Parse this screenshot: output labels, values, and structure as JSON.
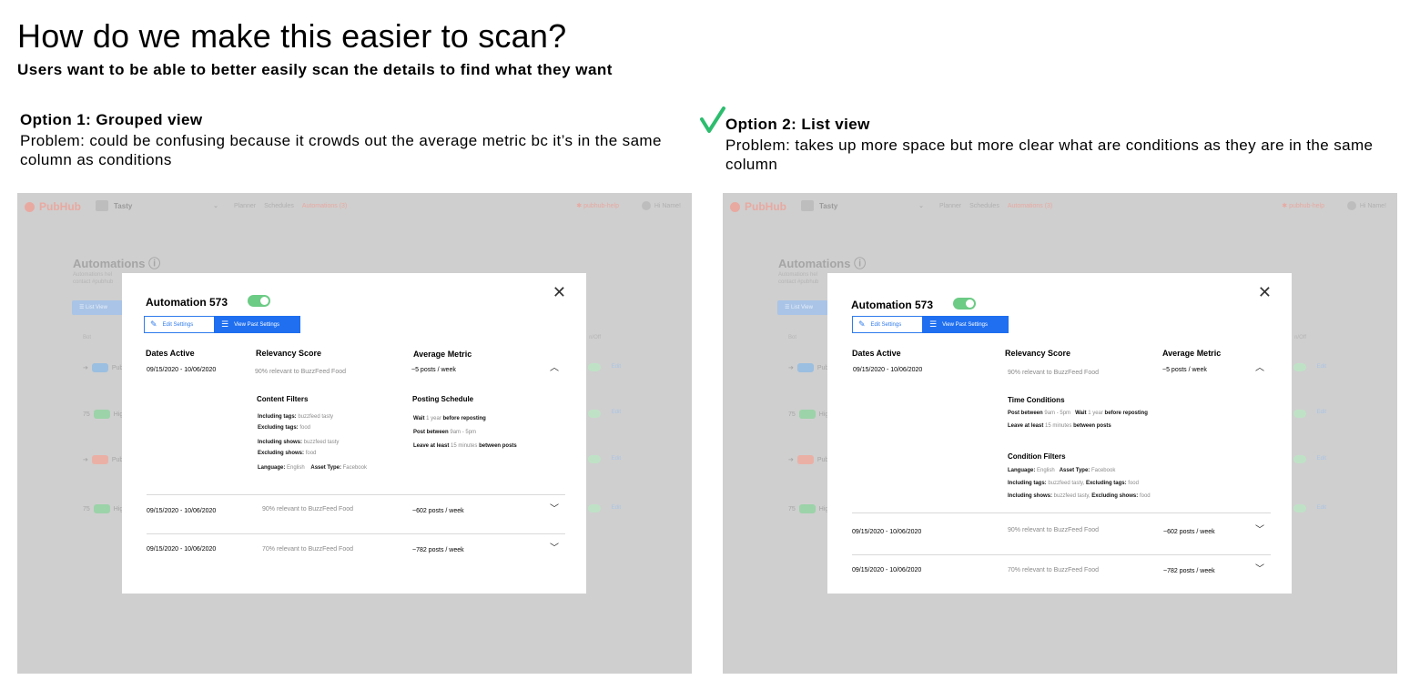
{
  "page": {
    "title": "How do we make this easier to scan?",
    "subtitle": "Users want to be able to better easily scan the details to find what they want"
  },
  "options": [
    {
      "title": "Option 1: Grouped view",
      "problem": "Problem: could be confusing because it crowds out the average metric bc it’s in the same column as conditions",
      "chosen": false
    },
    {
      "title": "Option 2: List view",
      "problem": "Problem: takes up more space but more clear what are conditions as they are in the same column",
      "chosen": true,
      "check_icon": "checkmark-icon",
      "check_color": "#2dbd6e"
    }
  ],
  "app": {
    "logo": "PubHub",
    "brand": "Tasty",
    "nav": [
      "Planner",
      "Schedules",
      "Automations (3)"
    ],
    "help": "pubhub-help",
    "user": "Hi Name!",
    "bg_title": "Automations",
    "bg_desc_1": "Automations hel",
    "bg_desc_2": "contact #pubhub",
    "bg_list_btn": "List View",
    "bg_col": "Bot",
    "bg_onoff": "n/Off",
    "bg_rows": [
      {
        "prefix": "➔",
        "badge": "blue",
        "text": "Pub"
      },
      {
        "prefix": "75",
        "badge": "green",
        "text": "High"
      },
      {
        "prefix": "➔",
        "badge": "red",
        "text": "Publ"
      },
      {
        "prefix": "75",
        "badge": "green",
        "text": "High"
      }
    ],
    "edit": "Edit"
  },
  "modal": {
    "title": "Automation 573",
    "toggle_on": true,
    "edit_settings": "Edit Settings",
    "view_past": "View Past Settings",
    "headers": [
      "Dates Active",
      "Relevancy Score",
      "Average Metric"
    ],
    "rows": [
      {
        "dates": "09/15/2020 - 10/06/2020",
        "relevancy": "90% relevant to BuzzFeed Food",
        "metric": "~5 posts / week",
        "expanded": true
      },
      {
        "dates": "09/15/2020 - 10/06/2020",
        "relevancy": "90% relevant to BuzzFeed Food",
        "metric": "~602 posts / week",
        "expanded": false
      },
      {
        "dates": "09/15/2020 - 10/06/2020",
        "relevancy": "70% relevant to BuzzFeed Food",
        "metric": "~782 posts / week",
        "expanded": false
      }
    ],
    "opt1": {
      "content_filters": "Content Filters",
      "posting_schedule": "Posting Schedule",
      "cf": {
        "including_tags_l": "Including tags:",
        "including_tags_v": "buzzfeed tasty",
        "excluding_tags_l": "Excluding tags:",
        "excluding_tags_v": "food",
        "including_shows_l": "Including shows:",
        "including_shows_v": "buzzfeed tasty",
        "excluding_shows_l": "Excluding shows:",
        "excluding_shows_v": "food",
        "language_l": "Language:",
        "language_v": "English",
        "asset_l": "Asset Type:",
        "asset_v": "Facebook"
      },
      "ps": {
        "wait_l": "Wait",
        "wait_v": "1 year",
        "wait_r": "before reposting",
        "between_l": "Post between",
        "between_v": "9am - 5pm",
        "least_l": "Leave at least",
        "least_v": "15 minutes",
        "least_r": "between posts"
      }
    },
    "opt2": {
      "time_conditions": "Time Conditions",
      "condition_filters": "Condition Filters",
      "tc": {
        "between_l": "Post between",
        "between_v": "9am - 5pm",
        "wait_l": "Wait",
        "wait_v": "1 year",
        "wait_r": "before reposting",
        "least_l": "Leave at least",
        "least_v": "15 minutes",
        "least_r": "between posts"
      },
      "cf": {
        "language_l": "Language:",
        "language_v": "English",
        "asset_l": "Asset Type:",
        "asset_v": "Facebook",
        "including_tags_l": "Including tags:",
        "including_tags_v": "buzzfeed tasty,",
        "excluding_tags_l": "Excluding tags:",
        "excluding_tags_v": "food",
        "including_shows_l": "Including shows:",
        "including_shows_v": "buzzfeed tasty,",
        "excluding_shows_l": "Excluding shows:",
        "excluding_shows_v": "food"
      }
    }
  }
}
